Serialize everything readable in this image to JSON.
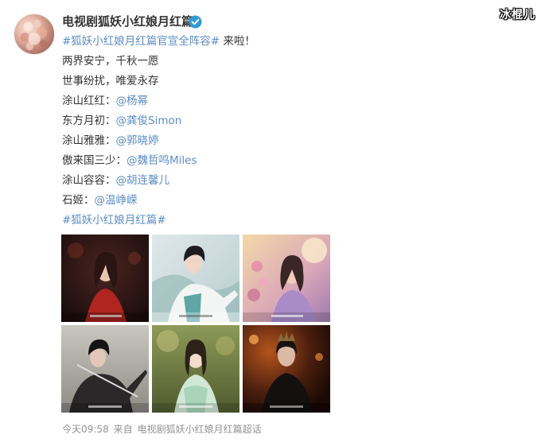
{
  "watermark": "冰棍儿",
  "author": {
    "name": "电视剧狐妖小红娘月红篇",
    "verified_icon": "verified-badge-icon"
  },
  "post": {
    "headline_topic": "#狐妖小红娘月红篇官宣全阵容#",
    "headline_suffix": " 来啦！",
    "line1": "两界安宁，千秋一愿",
    "line2": "世事纷扰，唯爱永存",
    "cast": [
      {
        "role": "涂山红红：",
        "mention": "@杨幂"
      },
      {
        "role": "东方月初：",
        "mention": "@龚俊Simon"
      },
      {
        "role": "涂山雅雅：",
        "mention": "@郭晓婷"
      },
      {
        "role": "傲来国三少：",
        "mention": "@魏哲鸣Miles"
      },
      {
        "role": "涂山容容：",
        "mention": "@胡连馨儿"
      },
      {
        "role": "石姬：",
        "mention": "@温峥嵘"
      }
    ],
    "footer_topic": "#狐妖小红娘月红篇#"
  },
  "footer": {
    "time": "今天09:58",
    "source_prefix": "来自",
    "source": "电视剧狐妖小红娘月红篇超话"
  },
  "colors": {
    "link": "#5b8dc7",
    "text": "#333333",
    "meta": "#939393",
    "verified": "#2f9bd6"
  }
}
